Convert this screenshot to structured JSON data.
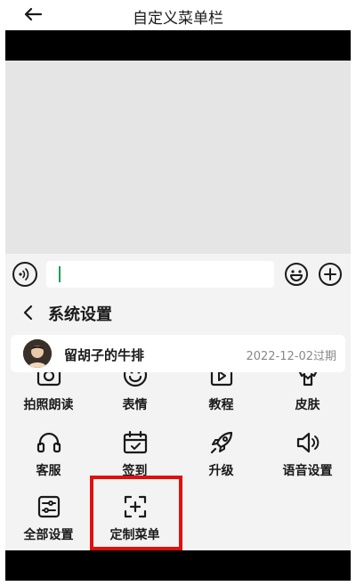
{
  "header": {
    "title": "自定义菜单栏"
  },
  "settings": {
    "title": "系统设置"
  },
  "user": {
    "name": "留胡子的牛排",
    "expire_text": "2022-12-02过期"
  },
  "menu_rows": [
    {
      "items": [
        {
          "label": "拍照朗读",
          "icon": "camera-icon"
        },
        {
          "label": "表情",
          "icon": "smiley-icon"
        },
        {
          "label": "教程",
          "icon": "play-book-icon"
        },
        {
          "label": "皮肤",
          "icon": "shirt-icon"
        }
      ]
    },
    {
      "items": [
        {
          "label": "客服",
          "icon": "headset-icon"
        },
        {
          "label": "签到",
          "icon": "calendar-check-icon"
        },
        {
          "label": "升级",
          "icon": "rocket-icon"
        },
        {
          "label": "语音设置",
          "icon": "speaker-icon"
        }
      ]
    },
    {
      "items": [
        {
          "label": "全部设置",
          "icon": "sliders-icon"
        },
        {
          "label": "定制菜单",
          "icon": "custom-menu-icon"
        }
      ]
    }
  ],
  "colors": {
    "accent_cursor": "#18a058",
    "highlight": "#e01010",
    "panel_bg": "#f3f3f3",
    "chat_bg": "#e5e5e5"
  }
}
